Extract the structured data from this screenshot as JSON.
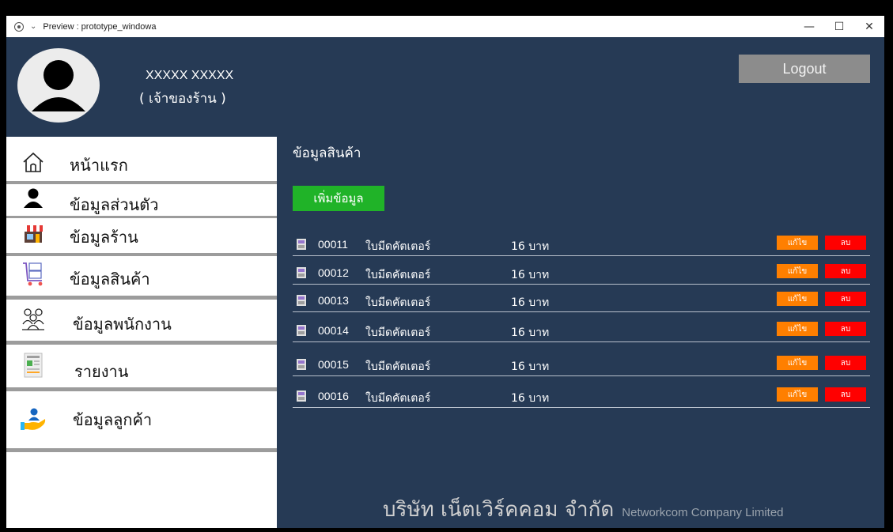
{
  "window": {
    "title": "Preview : prototype_windowa",
    "controls": {
      "minimize": "—",
      "maximize": "☐",
      "close": "✕"
    }
  },
  "user": {
    "name": "XXXXX XXXXX",
    "role": "( เจ้าของร้าน )"
  },
  "header": {
    "logout_label": "Logout"
  },
  "sidebar": {
    "items": [
      {
        "label": "หน้าแรก",
        "icon": "home-icon"
      },
      {
        "label": "ข้อมูลส่วนตัว",
        "icon": "person-icon"
      },
      {
        "label": "ข้อมูลร้าน",
        "icon": "shop-icon"
      },
      {
        "label": "ข้อมูลสินค้า",
        "icon": "product-cart-icon"
      },
      {
        "label": "ข้อมูลพนักงาน",
        "icon": "employees-icon"
      },
      {
        "label": "รายงาน",
        "icon": "report-icon"
      },
      {
        "label": "ข้อมูลลูกค้า",
        "icon": "customer-hand-icon"
      }
    ]
  },
  "main": {
    "section_title": "ข้อมูลสินค้า",
    "add_label": "เพิ่มข้อมูล",
    "products": [
      {
        "code": "00011",
        "name": "ใบมีดคัตเตอร์",
        "price": "16 บาท",
        "edit": "แก้ไข",
        "delete": "ลบ"
      },
      {
        "code": "00012",
        "name": "ใบมีดคัตเตอร์",
        "price": "16 บาท",
        "edit": "แก้ไข",
        "delete": "ลบ"
      },
      {
        "code": "00013",
        "name": "ใบมีดคัตเตอร์",
        "price": "16 บาท",
        "edit": "แก้ไข",
        "delete": "ลบ"
      },
      {
        "code": "00014",
        "name": "ใบมีดคัตเตอร์",
        "price": "16 บาท",
        "edit": "แก้ไข",
        "delete": "ลบ"
      },
      {
        "code": "00015",
        "name": "ใบมีดคัตเตอร์",
        "price": "16 บาท",
        "edit": "แก้ไข",
        "delete": "ลบ"
      },
      {
        "code": "00016",
        "name": "ใบมีดคัตเตอร์",
        "price": "16 บาท",
        "edit": "แก้ไข",
        "delete": "ลบ"
      }
    ]
  },
  "footer": {
    "company_th": "บริษัท เน็ตเวิร์คคอม จำกัด",
    "company_en": "Networkcom Company Limited"
  },
  "colors": {
    "background": "#263a55",
    "add_button": "#20b328",
    "edit_button": "#ff7f00",
    "delete_button": "#ff0000",
    "logout_button": "#8c8c8c"
  }
}
